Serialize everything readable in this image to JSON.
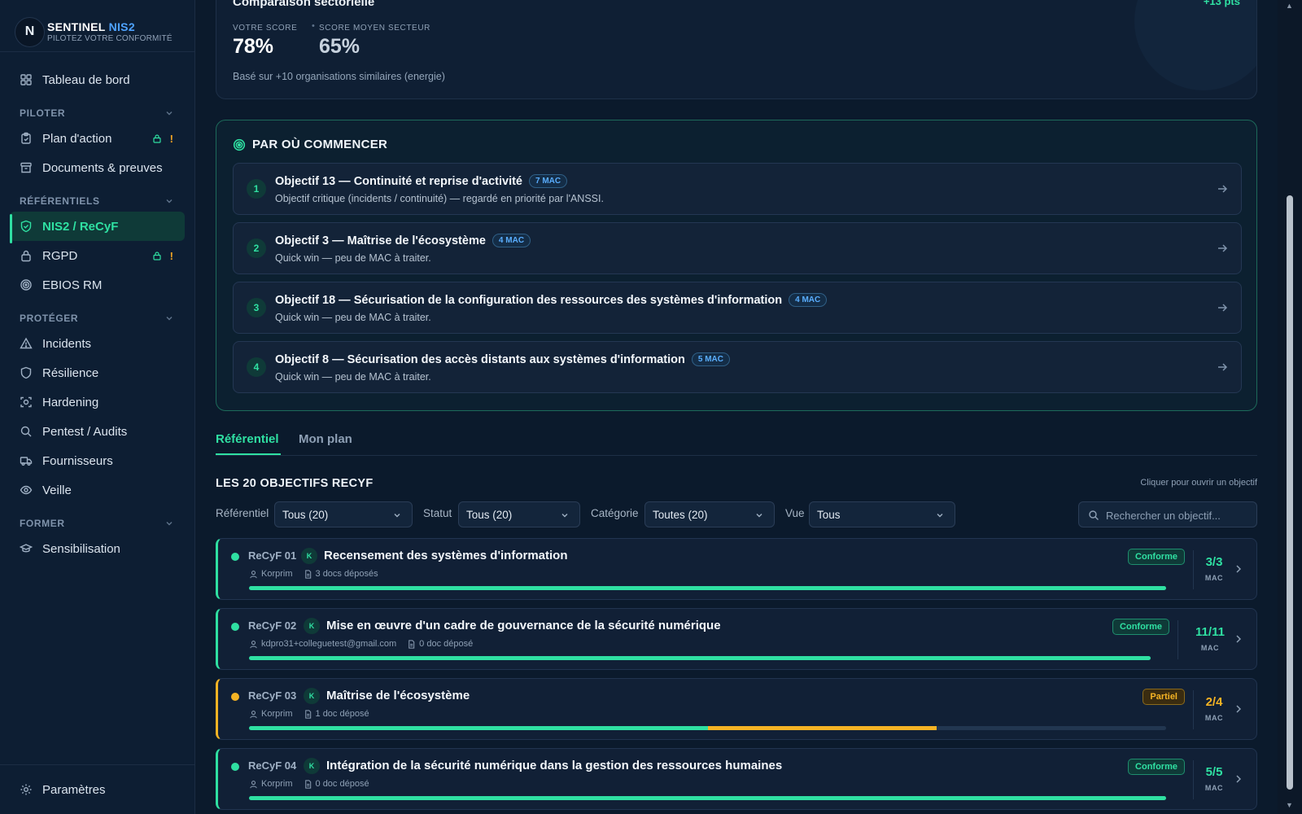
{
  "brand": {
    "logo_letter": "N",
    "name_part1": "SENTINEL",
    "name_part2": "NIS2",
    "tagline": "PILOTEZ VOTRE CONFORMITÉ"
  },
  "sidebar": {
    "dashboard": "Tableau de bord",
    "sections": {
      "piloter": "PILOTER",
      "referentiels": "RÉFÉRENTIELS",
      "proteger": "PROTÉGER",
      "former": "FORMER"
    },
    "items": {
      "plan_action": "Plan d'action",
      "documents": "Documents & preuves",
      "nis2": "NIS2 / ReCyF",
      "rgpd": "RGPD",
      "ebios": "EBIOS RM",
      "incidents": "Incidents",
      "resilience": "Résilience",
      "hardening": "Hardening",
      "pentest": "Pentest / Audits",
      "fournisseurs": "Fournisseurs",
      "veille": "Veille",
      "sensibilisation": "Sensibilisation"
    },
    "alert_mark": "!",
    "settings": "Paramètres"
  },
  "comparison": {
    "title": "Comparaison sectorielle",
    "delta": "+13 pts",
    "your_score_label": "VOTRE SCORE",
    "your_score": "78%",
    "dot": "•",
    "sector_label": "SCORE MOYEN SECTEUR",
    "sector_score": "65%",
    "note": "Basé sur +10 organisations similaires (energie)"
  },
  "start": {
    "title": "PAR OÙ COMMENCER",
    "steps": [
      {
        "num": "1",
        "title": "Objectif 13 — Continuité et reprise d'activité",
        "badge": "7 MAC",
        "desc": "Objectif critique (incidents / continuité) — regardé en priorité par l'ANSSI."
      },
      {
        "num": "2",
        "title": "Objectif 3 — Maîtrise de l'écosystème",
        "badge": "4 MAC",
        "desc": "Quick win — peu de MAC à traiter."
      },
      {
        "num": "3",
        "title": "Objectif 18 — Sécurisation de la configuration des ressources des systèmes d'information",
        "badge": "4 MAC",
        "desc": "Quick win — peu de MAC à traiter."
      },
      {
        "num": "4",
        "title": "Objectif 8 — Sécurisation des accès distants aux systèmes d'information",
        "badge": "5 MAC",
        "desc": "Quick win — peu de MAC à traiter."
      }
    ]
  },
  "tabs": {
    "referentiel": "Référentiel",
    "plan": "Mon plan"
  },
  "list": {
    "title": "LES 20 OBJECTIFS RECYF",
    "hint": "Cliquer pour ouvrir un objectif",
    "filters": {
      "referentiel_label": "Référentiel",
      "referentiel_value": "Tous (20)",
      "statut_label": "Statut",
      "statut_value": "Tous (20)",
      "categorie_label": "Catégorie",
      "categorie_value": "Toutes (20)",
      "vue_label": "Vue",
      "vue_value": "Tous"
    },
    "search_placeholder": "Rechercher un objectif...",
    "mac_unit": "MAC",
    "objectives": [
      {
        "code": "ReCyF 01",
        "avatar": "K",
        "title": "Recensement des systèmes d'information",
        "owner": "Korprim",
        "docs": "3 docs déposés",
        "status": "Conforme",
        "count": "3/3",
        "done_fraction": 1.0,
        "partial_fraction": 0.0
      },
      {
        "code": "ReCyF 02",
        "avatar": "K",
        "title": "Mise en œuvre d'un cadre de gouvernance de la sécurité numérique",
        "owner": "kdpro31+colleguetest@gmail.com",
        "docs": "0 doc déposé",
        "status": "Conforme",
        "count": "11/11",
        "done_fraction": 1.0,
        "partial_fraction": 0.0
      },
      {
        "code": "ReCyF 03",
        "avatar": "K",
        "title": "Maîtrise de l'écosystème",
        "owner": "Korprim",
        "docs": "1 doc déposé",
        "status": "Partiel",
        "count": "2/4",
        "done_fraction": 0.5,
        "partial_fraction": 0.25
      },
      {
        "code": "ReCyF 04",
        "avatar": "K",
        "title": "Intégration de la sécurité numérique dans la gestion des ressources humaines",
        "owner": "Korprim",
        "docs": "0 doc déposé",
        "status": "Conforme",
        "count": "5/5",
        "done_fraction": 1.0,
        "partial_fraction": 0.0
      }
    ]
  },
  "colors": {
    "accent": "#2fe0a2",
    "warning": "#f5b324",
    "brand_blue": "#4ea3ff",
    "background": "#0b1a2c"
  }
}
